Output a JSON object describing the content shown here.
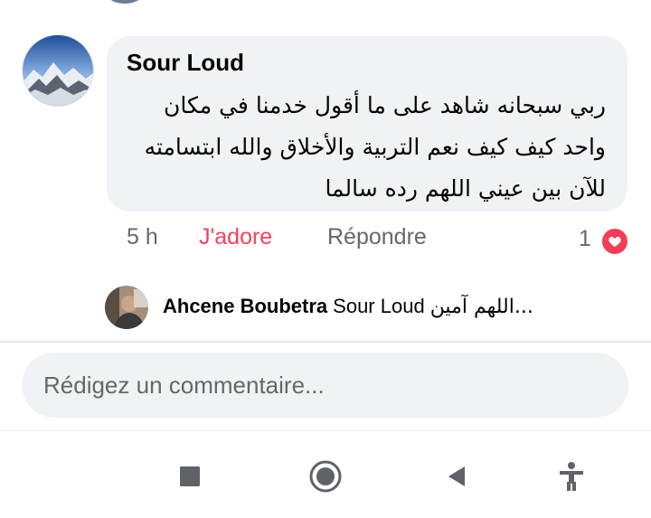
{
  "comment": {
    "author": "Sour Loud",
    "text": "ربي سبحانه شاهد على ما أقول خدمنا في مكان واحد كيف كيف نعم التربية والأخلاق والله ابتسامته للآن بين عيني اللهم رده سالما",
    "time": "5 h",
    "like_label": "J'adore",
    "reply_label": "Répondre",
    "reaction_count": "1",
    "reaction_icon": "heart-icon",
    "like_color": "#f3425f"
  },
  "reply_preview": {
    "author": "Ahcene Boubetra",
    "mention": "Sour Loud",
    "snippet": "اللهم آمين..."
  },
  "composer": {
    "placeholder": "Rédigez un commentaire..."
  },
  "navbar": {
    "icons": [
      "recents-icon",
      "home-icon",
      "back-icon",
      "accessibility-icon"
    ]
  }
}
